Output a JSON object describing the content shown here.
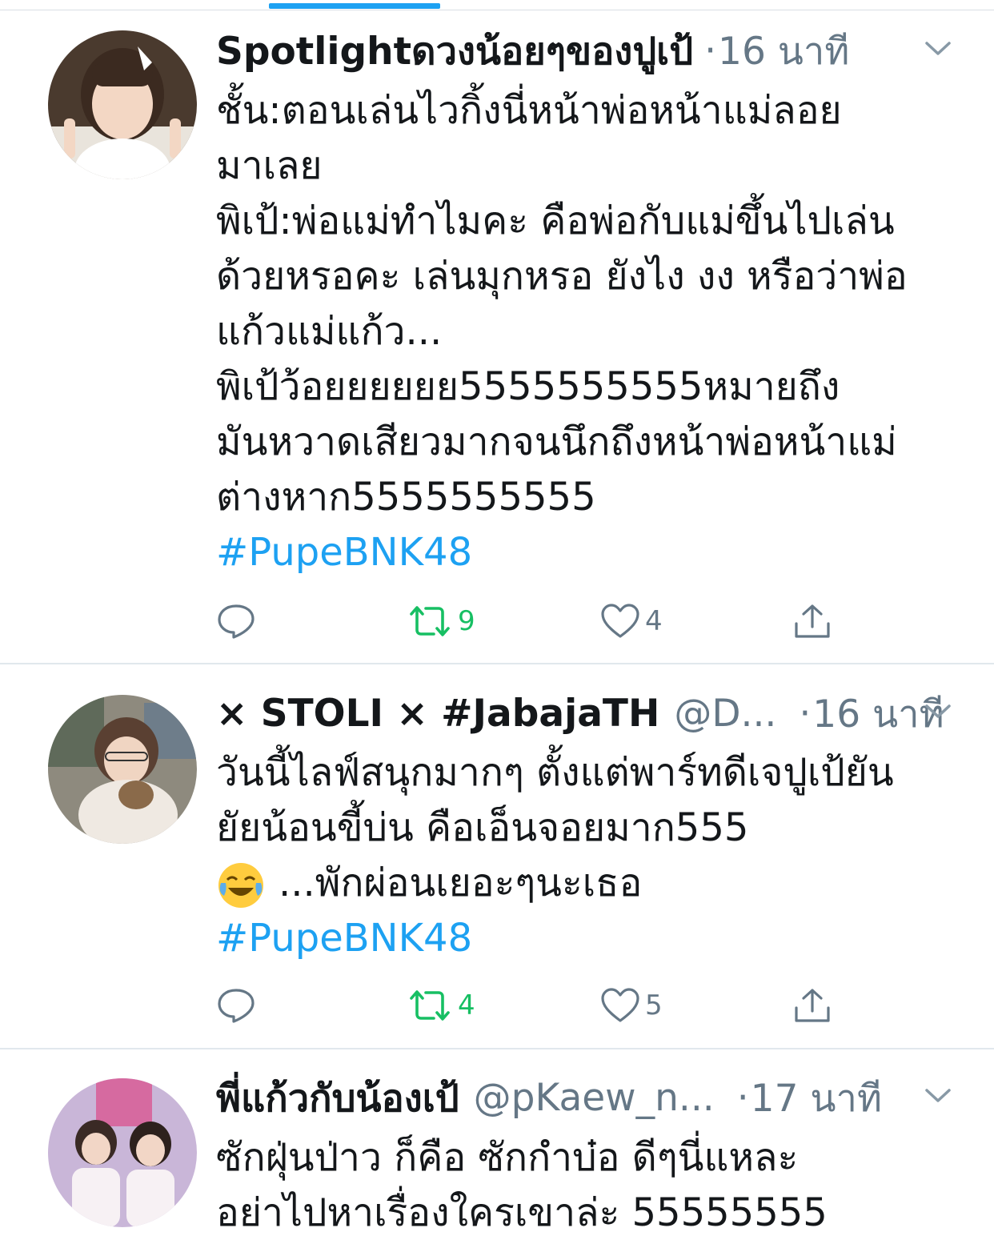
{
  "tweets": [
    {
      "display_name": "Spotlightดวงน้อยๆของปูเป้",
      "handle": "",
      "dot": "·",
      "timestamp": "16 นาที",
      "lines": [
        "ชั้น:ตอนเล่นไวกิ้งนี่หน้าพ่อหน้าแม่ลอย",
        "มาเลย",
        "พิเป้:พ่อแม่ทำไมคะ คือพ่อกับแม่ขึ้นไปเล่น",
        "ด้วยหรอคะ เล่นมุกหรอ ยังไง งง หรือว่าพ่อ",
        "แก้วแม่แก้ว...",
        "พิเป้ว้อยยยยยย5555555555หมายถึง",
        "มันหวาดเสียวมากจนนึกถึงหน้าพ่อหน้าแม่",
        "ต่างหาก5555555555"
      ],
      "hashtag": "#PupeBNK48",
      "retweets": "9",
      "likes": "4"
    },
    {
      "display_name": "× STOLI × #JabajaTH",
      "handle": "@D...",
      "dot": "·",
      "timestamp": "16 นาที",
      "lines": [
        "วันนี้ไลฟ์สนุกมากๆ ตั้งแต่พาร์ทดีเจปูเป้ยัน",
        "ยัยน้อนขี้บ่น คือเอ็นจอยมาก555",
        "...พักผ่อนเยอะๆนะเธอ"
      ],
      "emoji": "face-with-tears-of-joy",
      "hashtag": "#PupeBNK48",
      "retweets": "4",
      "likes": "5"
    },
    {
      "display_name": "พี่แก้วกับน้องเป้",
      "handle": "@pKaew_n...",
      "dot": "·",
      "timestamp": "17 นาที",
      "lines": [
        "ซักฝุ่นป่าว ก็คือ ซักกำบ๋อ ดีๆนี่แหละ",
        "อย่าไปหาเรื่องใครเขาล่ะ 55555555"
      ]
    }
  ],
  "icons": {
    "reply": "reply-bubble-icon",
    "retweet": "retweet-icon",
    "like": "heart-icon",
    "share": "share-icon",
    "caret": "chevron-down-icon"
  },
  "colors": {
    "accent": "#1da1f2",
    "retweet_active": "#17bf63",
    "secondary_text": "#657786",
    "divider": "#e1e8ed"
  }
}
